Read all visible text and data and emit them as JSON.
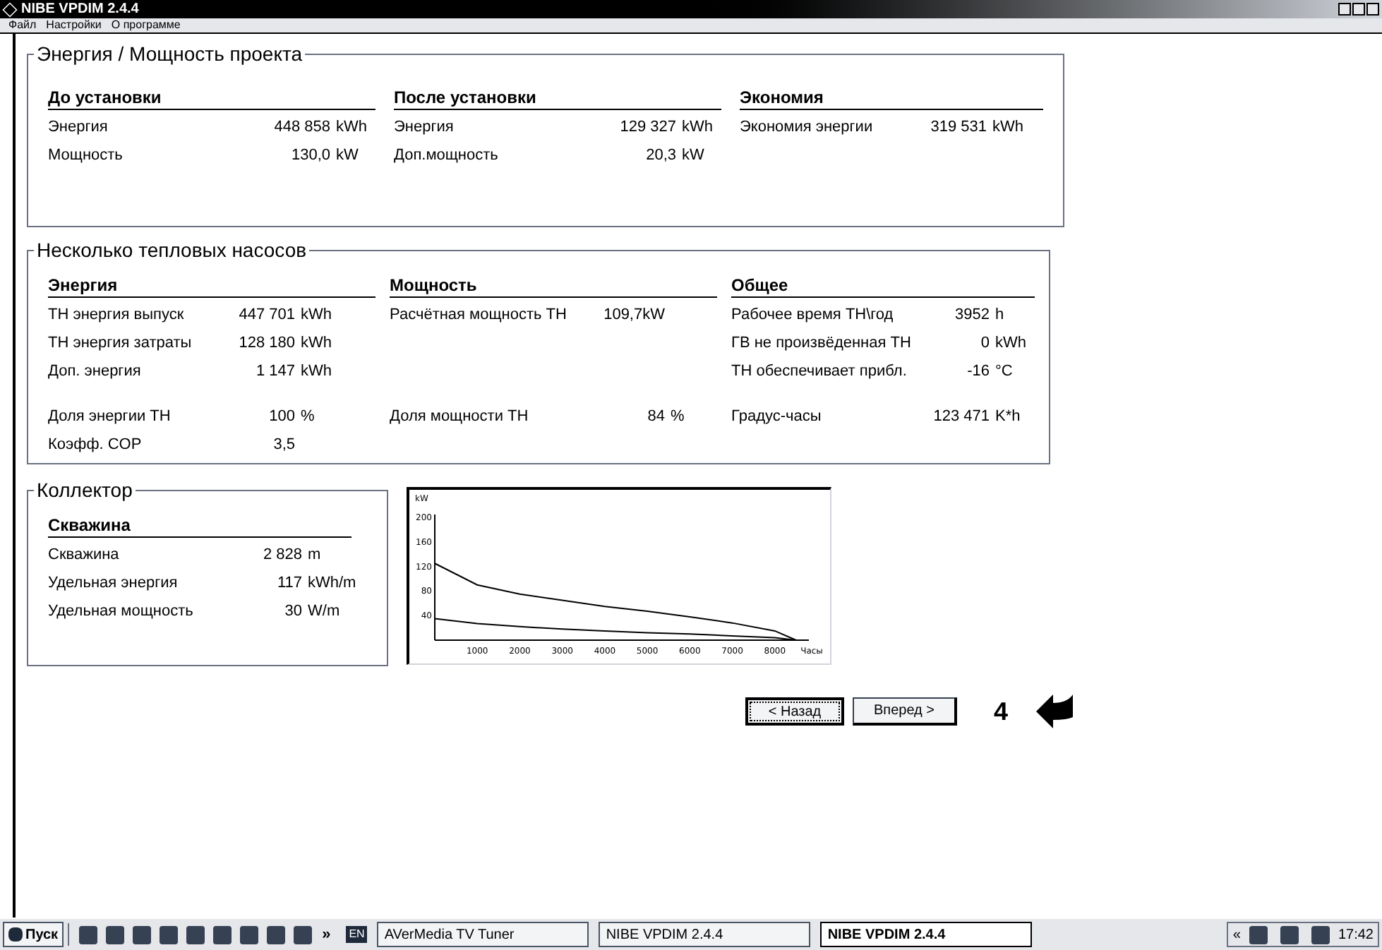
{
  "window": {
    "title": "NIBE VPDIM 2.4.4"
  },
  "menu": [
    "Файл",
    "Настройки",
    "О программе"
  ],
  "project": {
    "title": "Энергия / Мощность проекта",
    "columns": [
      {
        "heading": "До установки",
        "rows": [
          {
            "label": "Энергия",
            "value": "448 858",
            "unit": "kWh"
          },
          {
            "label": "Мощность",
            "value": "130,0",
            "unit": "kW"
          }
        ]
      },
      {
        "heading": "После установки",
        "rows": [
          {
            "label": "Энергия",
            "value": "129 327",
            "unit": "kWh"
          },
          {
            "label": "Доп.мощность",
            "value": "20,3",
            "unit": "kW"
          }
        ]
      },
      {
        "heading": "Экономия",
        "rows": [
          {
            "label": "Экономия энергии",
            "value": "319 531",
            "unit": "kWh"
          }
        ]
      }
    ]
  },
  "pumps": {
    "title": "Несколько тепловых насосов",
    "columns": [
      {
        "heading": "Энергия",
        "top": [
          {
            "label": "ТН энергия выпуск",
            "value": "447 701",
            "unit": "kWh"
          },
          {
            "label": "ТН энергия затраты",
            "value": "128 180",
            "unit": "kWh"
          },
          {
            "label": "Доп. энергия",
            "value": "1 147",
            "unit": "kWh"
          }
        ],
        "bottom": [
          {
            "label": "Доля энергии ТН",
            "value": "100",
            "unit": "%"
          },
          {
            "label": "Коэфф. COP",
            "value": "3,5"
          }
        ]
      },
      {
        "heading": "Мощность",
        "top": [
          {
            "label": "Расчётная мощность ТН",
            "value": "109,7kW"
          }
        ],
        "bottom": [
          {
            "label": "Доля мощности ТН",
            "value": "84",
            "unit": "%"
          }
        ]
      },
      {
        "heading": "Общее",
        "top": [
          {
            "label": "Рабочее время ТН\\год",
            "value": "3952",
            "unit": "h"
          },
          {
            "label": "ГВ не произвёденная ТН",
            "value": "0",
            "unit": "kWh"
          },
          {
            "label": "ТН обеспечивает прибл.",
            "value": "-16",
            "unit": "°C"
          }
        ],
        "bottom": [
          {
            "label": "Градус-часы",
            "value": "123 471",
            "unit": "K*h"
          }
        ]
      }
    ]
  },
  "collector": {
    "title": "Коллектор",
    "heading": "Скважина",
    "rows": [
      {
        "label": "Скважина",
        "value": "2 828",
        "unit": "m"
      },
      {
        "label": "Удельная энергия",
        "value": "117",
        "unit": "kWh/m"
      },
      {
        "label": "Удельная мощность",
        "value": "30",
        "unit": "W/m"
      }
    ]
  },
  "chart_data": {
    "type": "line",
    "ylabel": "kW",
    "xlabel": "Часы",
    "x": [
      0,
      1000,
      2000,
      3000,
      4000,
      5000,
      6000,
      7000,
      8000,
      8500
    ],
    "series": [
      {
        "color": "#000000",
        "values": [
          125,
          90,
          75,
          65,
          55,
          47,
          38,
          28,
          15,
          0
        ]
      },
      {
        "color": "#000000",
        "values": [
          35,
          27,
          22,
          18,
          15,
          12,
          10,
          7,
          4,
          0
        ]
      }
    ],
    "xticks": [
      1000,
      2000,
      3000,
      4000,
      5000,
      6000,
      7000,
      8000
    ],
    "yticks": [
      40,
      80,
      120,
      160,
      200
    ],
    "xlim": [
      0,
      8800
    ],
    "ylim": [
      0,
      200
    ]
  },
  "nav": {
    "back": "< Назад",
    "next": "Вперед >",
    "step": "4"
  },
  "taskbar": {
    "start": "Пуск",
    "more": "»",
    "lang": "EN",
    "tasks": [
      {
        "label": "AVerMedia TV Tuner",
        "selected": false
      },
      {
        "label": "NIBE VPDIM 2.4.4",
        "selected": false
      },
      {
        "label": "NIBE VPDIM 2.4.4",
        "selected": true
      }
    ],
    "tray_more": "«",
    "clock": "17:42"
  }
}
